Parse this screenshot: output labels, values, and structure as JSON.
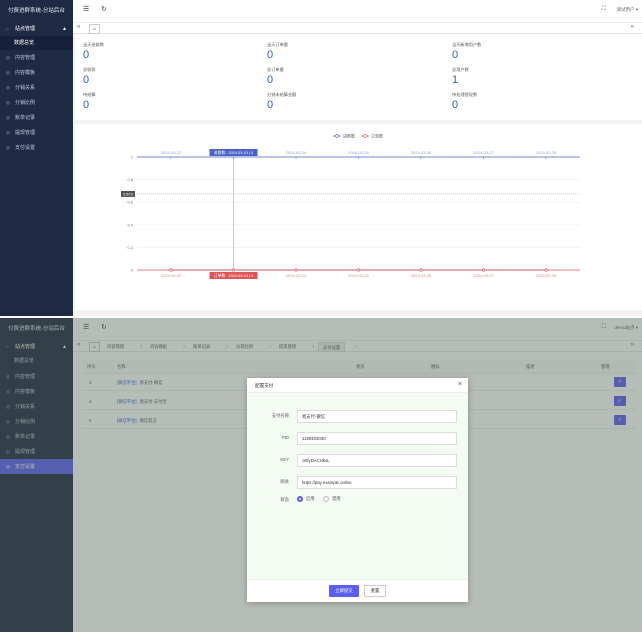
{
  "app": {
    "title": "付费进群系统-分站后台",
    "user": "测试用户",
    "user2": "demo站点"
  },
  "sidebar": {
    "group": "站点管理",
    "sub": "数据总览",
    "items": [
      "内容管理",
      "内容模板",
      "分销关系",
      "分销比例",
      "账单记录",
      "提现管理",
      "支付设置"
    ]
  },
  "tabs_top": {
    "home": "⌂"
  },
  "tabs2": [
    "内容管理",
    "内容模板",
    "账单记录",
    "分销比例",
    "提现管理",
    "支付设置"
  ],
  "stats": [
    {
      "label": "当天进群数",
      "value": "0"
    },
    {
      "label": "当天订单量",
      "value": "0"
    },
    {
      "label": "当天新增用户数",
      "value": "0"
    },
    {
      "label": "总收款",
      "value": "0"
    },
    {
      "label": "总订单量",
      "value": "0"
    },
    {
      "label": "总用户数",
      "value": "1"
    },
    {
      "label": "待结算",
      "value": "0"
    },
    {
      "label": "分销未结算金额",
      "value": "0"
    },
    {
      "label": "待处理提现数",
      "value": "0"
    }
  ],
  "chart_data": {
    "type": "line",
    "x": [
      "2024-03-22",
      "2024-03-23",
      "2024-03-24",
      "2024-03-25",
      "2024-03-26",
      "2024-03-27",
      "2024-03-28"
    ],
    "series": [
      {
        "name": "进群数",
        "values": [
          0,
          0,
          0,
          0,
          0,
          0,
          0
        ],
        "color": "#4b63c9"
      },
      {
        "name": "订单数",
        "values": [
          0,
          0,
          0,
          0,
          0,
          0,
          0
        ],
        "color": "#e05555"
      }
    ],
    "y_ticks": [
      "1",
      "0.8",
      "0.6",
      "0.4",
      "0.2",
      "0"
    ],
    "ylim": [
      0,
      1
    ],
    "pointer_value": "0.673",
    "tooltip_top": "进群数 : 2024-03-23 | 0",
    "tooltip_bottom": "订单数 : 2024-03-23 | 0",
    "legend_position": "top-center",
    "colors": {
      "a": "#4b63c9",
      "b": "#e05555"
    }
  },
  "table": {
    "headers": [
      "序号",
      "名称",
      "状态",
      "图标",
      "描述",
      "管理"
    ],
    "rows": [
      {
        "id": "3",
        "tag": "[微信平台]",
        "name": "易支付-微信"
      },
      {
        "id": "4",
        "tag": "[微信平台]",
        "name": "易支付-支付宝"
      },
      {
        "id": "5",
        "tag": "[微信平台]",
        "name": "微信官方"
      }
    ],
    "edit_icon": "✓"
  },
  "dialog": {
    "title": "配置支付",
    "fields": [
      {
        "label": "支付名称",
        "value": "易支付-微信"
      },
      {
        "label": "PID",
        "value": "1180403030"
      },
      {
        "label": "KEY",
        "value": "c6llyDACHkuL"
      },
      {
        "label": "网关",
        "value": "https://pay.example.online"
      }
    ],
    "status_label": "状态",
    "status_on": "启用",
    "status_off": "禁用",
    "submit": "立即提交",
    "reset": "重置"
  }
}
